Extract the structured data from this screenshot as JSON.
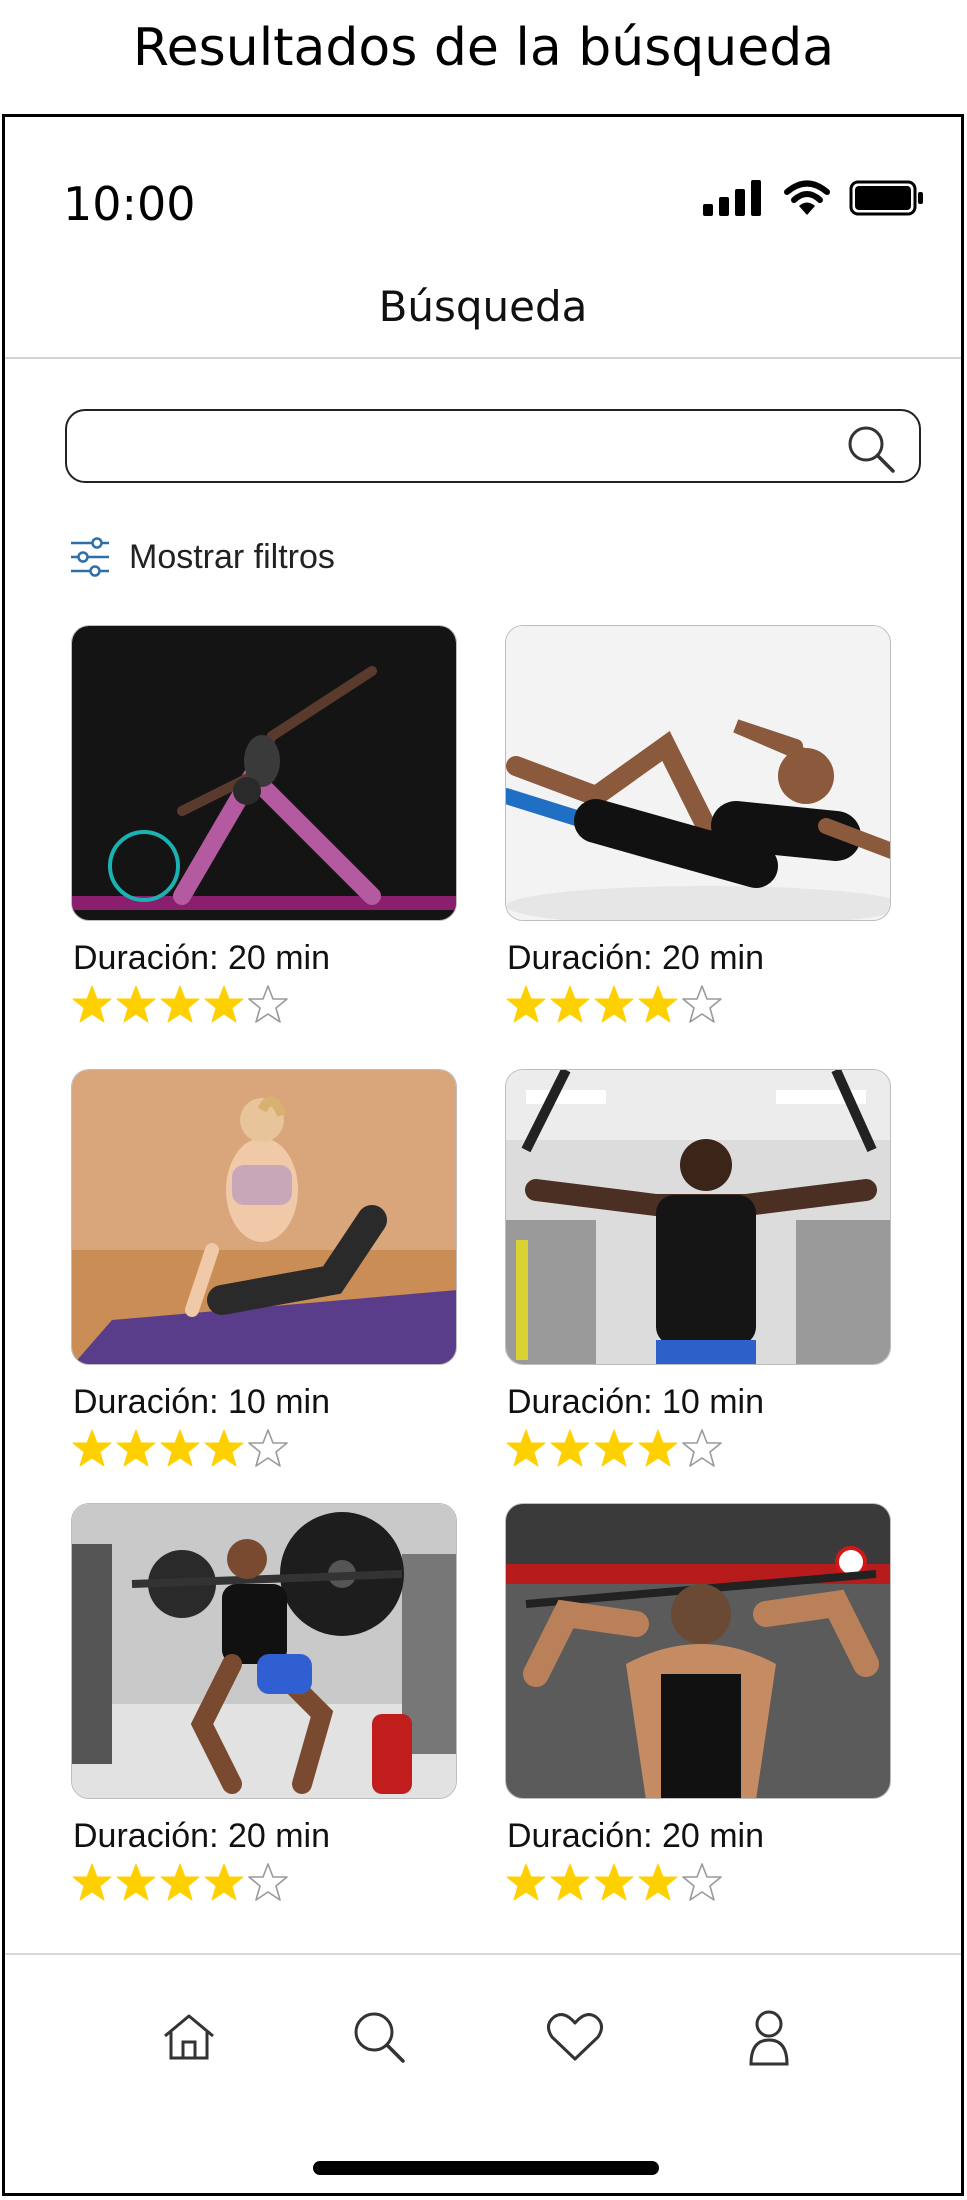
{
  "caption": "Resultados de la búsqueda",
  "status_bar": {
    "time": "10:00",
    "icons": [
      "signal-icon",
      "wifi-icon",
      "battery-icon"
    ]
  },
  "header": {
    "title": "Búsqueda"
  },
  "search": {
    "value": "",
    "placeholder": "",
    "icon": "search-icon"
  },
  "filters": {
    "label": "Mostrar filtros",
    "icon": "sliders-icon"
  },
  "results": [
    {
      "image": "yoga-triangle-pose-photo",
      "duration": "Duración: 20 min",
      "rating": 4,
      "max_rating": 5
    },
    {
      "image": "bicycle-crunch-photo",
      "duration": "Duración: 20 min",
      "rating": 4,
      "max_rating": 5
    },
    {
      "image": "yoga-pigeon-pose-photo",
      "duration": "Duración: 10 min",
      "rating": 4,
      "max_rating": 5
    },
    {
      "image": "cable-chest-fly-photo",
      "duration": "Duración: 10 min",
      "rating": 4,
      "max_rating": 5
    },
    {
      "image": "barbell-squat-photo",
      "duration": "Duración: 20 min",
      "rating": 4,
      "max_rating": 5
    },
    {
      "image": "lat-pulldown-back-photo",
      "duration": "Duración: 20 min",
      "rating": 4,
      "max_rating": 5
    }
  ],
  "colors": {
    "star_filled": "#FFD000",
    "star_empty": "#9a9a9a",
    "accent": "#000000"
  },
  "bottom_nav": [
    {
      "icon": "home-icon"
    },
    {
      "icon": "search-icon"
    },
    {
      "icon": "heart-icon"
    },
    {
      "icon": "user-icon"
    }
  ]
}
